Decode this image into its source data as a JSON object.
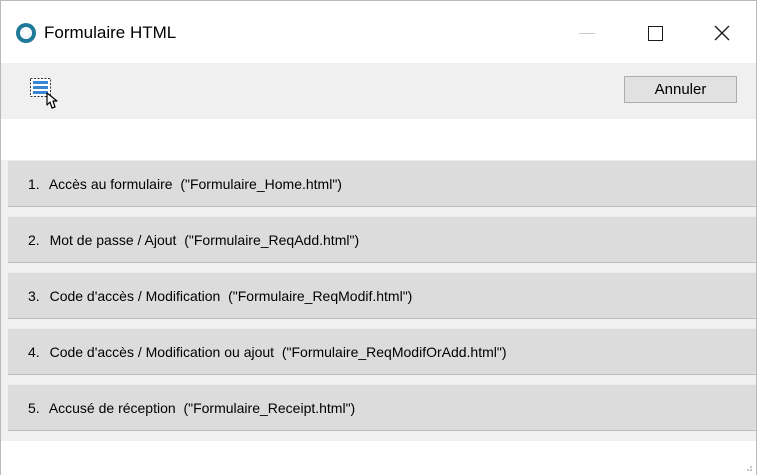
{
  "window": {
    "title": "Formulaire HTML"
  },
  "icons": {
    "app": "app-logo-icon",
    "tool": "html-form-cursor-icon",
    "minimize": "minimize-icon",
    "maximize": "maximize-icon",
    "close": "close-icon"
  },
  "toolbar": {
    "cancel_label": "Annuler"
  },
  "menu": {
    "items": [
      {
        "number": "1.",
        "label": "Accès au formulaire",
        "file": "(\"Formulaire_Home.html\")"
      },
      {
        "number": "2.",
        "label": "Mot de passe / Ajout",
        "file": "(\"Formulaire_ReqAdd.html\")"
      },
      {
        "number": "3.",
        "label": "Code d'accès / Modification",
        "file": "(\"Formulaire_ReqModif.html\")"
      },
      {
        "number": "4.",
        "label": "Code d'accès / Modification ou ajout",
        "file": "(\"Formulaire_ReqModifOrAdd.html\")"
      },
      {
        "number": "5.",
        "label": "Accusé de réception",
        "file": "(\"Formulaire_Receipt.html\")"
      }
    ]
  },
  "colors": {
    "accent": "#1f7a99",
    "menu_bg": "#dcdcdc",
    "window_bg": "#f0f0f0"
  }
}
